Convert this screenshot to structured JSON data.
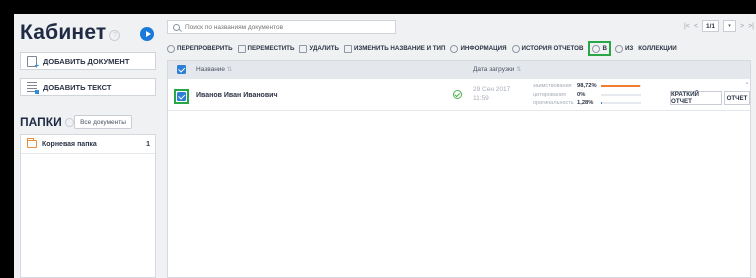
{
  "sidebar": {
    "title": "Кабинет",
    "help_glyph": "?",
    "add_document": "ДОБАВИТЬ ДОКУМЕНТ",
    "add_text": "ДОБАВИТЬ ТЕКСТ",
    "folders_title": "ПАПКИ",
    "all_documents": "Все документы",
    "folders": [
      {
        "name": "Корневая папка",
        "count": "1"
      }
    ]
  },
  "search": {
    "placeholder": "Поиск по названиям документов"
  },
  "pager": {
    "first": "|<",
    "prev": "<",
    "page": "1/1",
    "dropdown": "▾",
    "next": ">",
    "last": ">|"
  },
  "toolbar": {
    "recheck": "ПЕРЕПРОВЕРИТЬ",
    "move": "ПЕРЕМЕСТИТЬ",
    "delete": "УДАЛИТЬ",
    "rename": "ИЗМЕНИТЬ НАЗВАНИЕ И ТИП",
    "info": "ИНФОРМАЦИЯ",
    "history": "ИСТОРИЯ ОТЧЕТОВ",
    "to": "В",
    "from": "ИЗ",
    "collection": "КОЛЛЕКЦИИ"
  },
  "table": {
    "headers": {
      "name": "Название",
      "date": "Дата загрузки"
    },
    "rows": [
      {
        "name": "Иванов Иван Иванович",
        "date": "29 Сен 2017",
        "time": "11:59",
        "metrics": [
          {
            "label": "заимствования",
            "value": "98,72%",
            "fraction": 0.9872,
            "color": "#f07d32"
          },
          {
            "label": "цитирования",
            "value": "0%",
            "fraction": 0,
            "color": "#2fb36b"
          },
          {
            "label": "оригинальность",
            "value": "1,28%",
            "fraction": 0.0128,
            "color": "#2d8fd8"
          }
        ],
        "short_report": "КРАТКИЙ ОТЧЕТ",
        "report": "ОТЧЕТ"
      }
    ]
  },
  "colors": {
    "accent": "#2d7fd3",
    "highlight": "#27a745",
    "borrow": "#f07d32"
  }
}
